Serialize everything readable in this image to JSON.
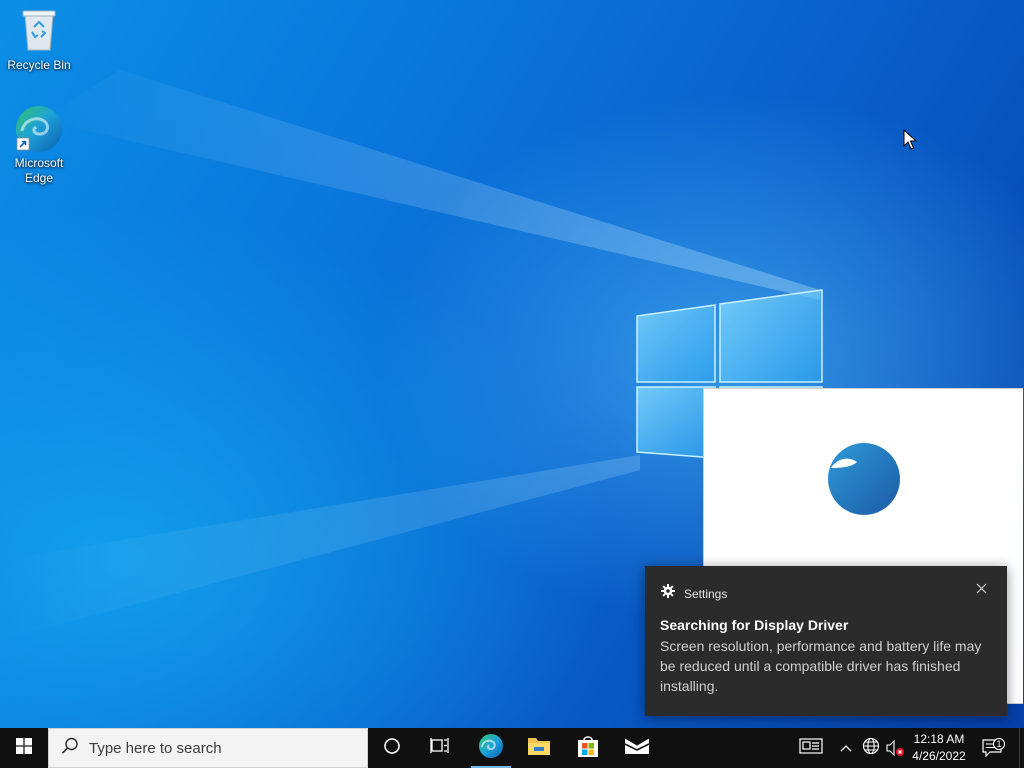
{
  "desktop": {
    "icons": [
      {
        "label": "Recycle Bin",
        "icon": "recycle-bin-icon"
      },
      {
        "label": "Microsoft\nEdge",
        "icon": "edge-icon"
      }
    ]
  },
  "splash": {
    "icon": "edge-logo-icon"
  },
  "toast": {
    "app_name": "Settings",
    "app_icon": "gear-icon",
    "title": "Searching for Display Driver",
    "body": "Screen resolution, performance and battery life may be reduced until a compatible driver has finished installing.",
    "close_icon": "close-icon"
  },
  "taskbar": {
    "search_placeholder": "Type here to search",
    "pinned": [
      "edge-icon",
      "file-explorer-icon",
      "store-icon",
      "mail-icon"
    ],
    "tray": {
      "time": "12:18 AM",
      "date": "4/26/2022",
      "notification_count": "1"
    }
  },
  "colors": {
    "taskbar_bg": "#101010",
    "toast_bg": "#2b2b2b",
    "accent": "#76b9ed"
  }
}
